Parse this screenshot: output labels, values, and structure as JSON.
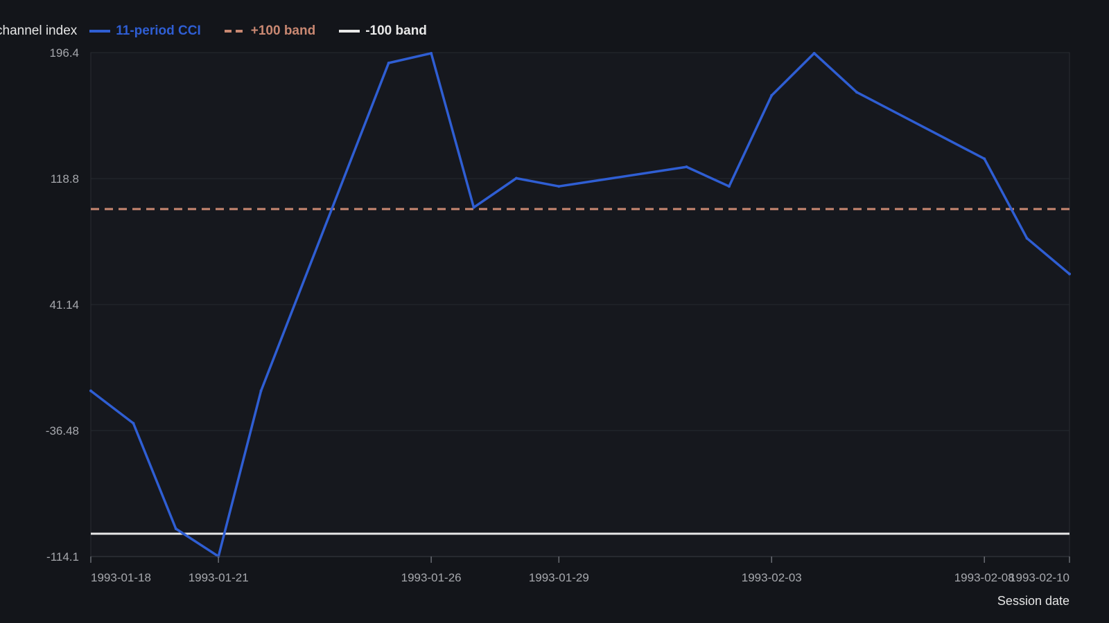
{
  "chart_data": {
    "type": "line",
    "title": "",
    "xlabel": "Session date",
    "ylabel": "channel index",
    "ylim": [
      -114.1,
      196.4
    ],
    "x_ticks": [
      "1993-01-18",
      "1993-01-21",
      "1993-01-26",
      "1993-01-29",
      "1993-02-03",
      "1993-02-08",
      "1993-02-10"
    ],
    "y_ticks": [
      "196.4",
      "118.8",
      "41.14",
      "-36.48",
      "-114.1"
    ],
    "grid": true,
    "legend_position": "top-left",
    "x": [
      "1993-01-18",
      "1993-01-19",
      "1993-01-20",
      "1993-01-21",
      "1993-01-22",
      "1993-01-25",
      "1993-01-26",
      "1993-01-27",
      "1993-01-28",
      "1993-01-29",
      "1993-02-01",
      "1993-02-02",
      "1993-02-03",
      "1993-02-04",
      "1993-02-05",
      "1993-02-08",
      "1993-02-09",
      "1993-02-10"
    ],
    "series": [
      {
        "name": "11-period CCI",
        "color": "#2f5ed3",
        "style": "solid",
        "values": [
          -12,
          -32,
          -97,
          -114,
          -12,
          190,
          196,
          101,
          119,
          114,
          126,
          114,
          170,
          196,
          172,
          131,
          82,
          60
        ]
      },
      {
        "name": "+100 band",
        "color": "#c98872",
        "style": "dashed",
        "values": [
          100,
          100
        ]
      },
      {
        "name": "-100 band",
        "color": "#e8e8e8",
        "style": "solid",
        "values": [
          -100,
          -100
        ]
      }
    ]
  }
}
